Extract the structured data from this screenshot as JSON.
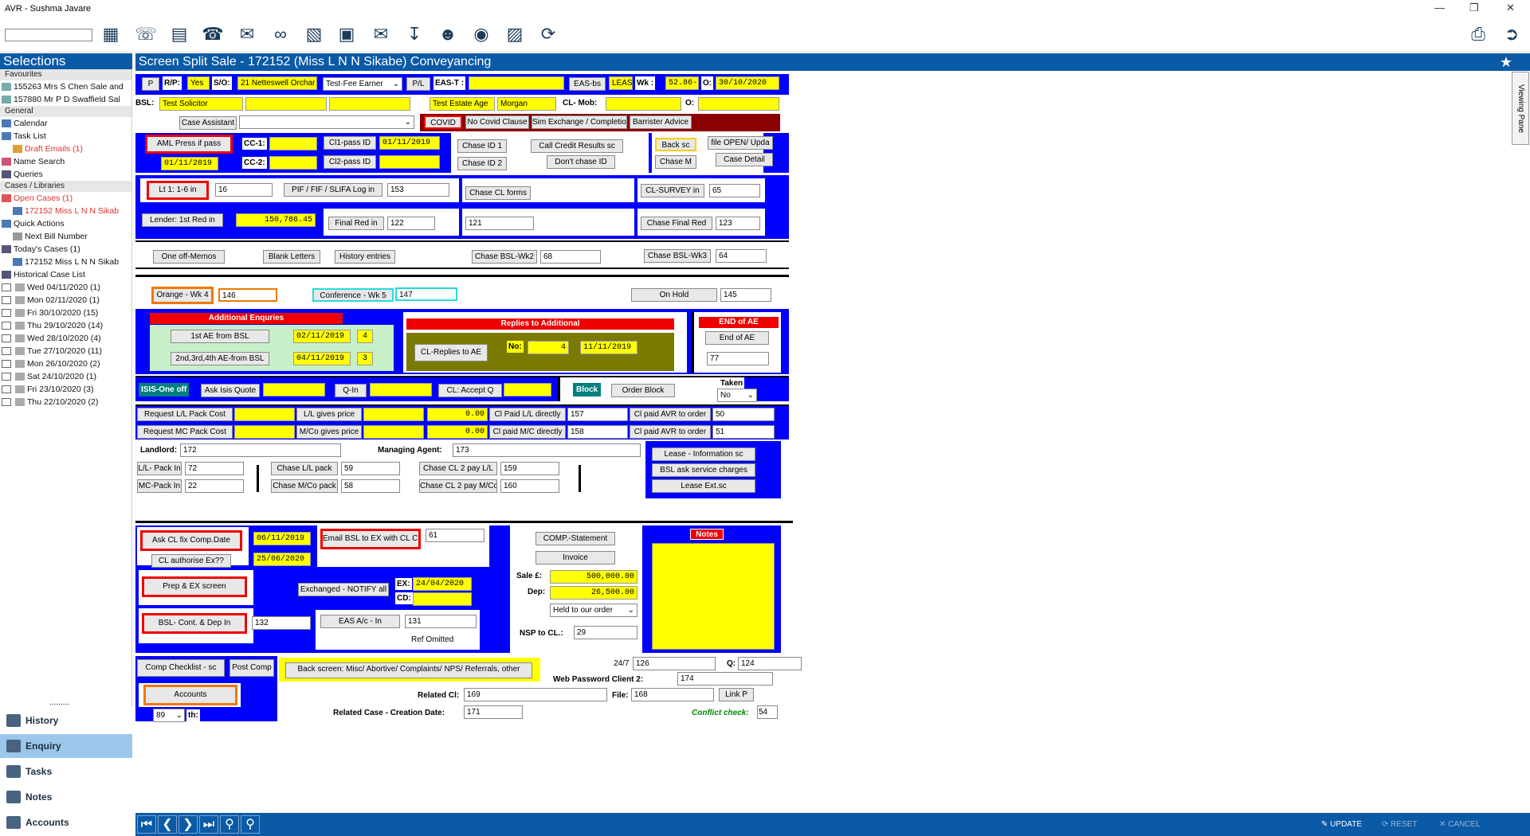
{
  "window": {
    "title": "AVR - Sushma Javare"
  },
  "toolbar": {
    "icons": [
      "add-case-icon",
      "phone-in-icon",
      "notes-icon",
      "phone-out-icon",
      "letter-edit-icon",
      "link-icon",
      "calculator-icon",
      "calendar-icon",
      "mail-icon",
      "download-icon",
      "people-icon",
      "coins-icon",
      "document-export-icon",
      "refresh-icon"
    ],
    "right_icons": [
      "printer-icon",
      "logout-icon"
    ]
  },
  "sidebar": {
    "title": "Selections",
    "favourites_header": "Favourites",
    "favourites": [
      "155263 Mrs S Chen Sale and",
      "157880 Mr P D Swaffield Sal"
    ],
    "general_header": "General",
    "general": [
      "Calendar",
      "Task List",
      "Draft Emails (1)",
      "Name Search",
      "Queries"
    ],
    "cases_header": "Cases / Libraries",
    "cases": [
      "Open Cases  (1)",
      "172152 Miss L N N Sikab",
      "Quick Actions",
      "Next Bill Number",
      "Today's Cases  (1)",
      "172152 Miss L N N Sikab",
      "Historical Case List"
    ],
    "history": [
      "Wed 04/11/2020  (1)",
      "Mon 02/11/2020  (1)",
      "Fri 30/10/2020  (15)",
      "Thu 29/10/2020  (14)",
      "Wed 28/10/2020  (4)",
      "Tue 27/10/2020  (11)",
      "Mon 26/10/2020  (2)",
      "Sat 24/10/2020  (1)",
      "Fri 23/10/2020  (3)",
      "Thu 22/10/2020  (2)"
    ],
    "nav": [
      "History",
      "Enquiry",
      "Tasks",
      "Notes",
      "Accounts"
    ],
    "grip": "........."
  },
  "screen": {
    "title": "Screen Split Sale - 172152 (Miss L N N Sikabe) Conveyancing",
    "viewing_pane": "Viewing Pane"
  },
  "row1": {
    "p": "P",
    "rp_label": "R/P:",
    "rp_value": "Yes",
    "so_label": "S/O:",
    "so_value": "21 Netteswell Orchar",
    "fee_earner": "Test-Fee Earner",
    "pl": "P/L",
    "eas_t": "EAS-T :",
    "eas_bs": "EAS-bs",
    "leas": "LEAS",
    "wk_label": "Wk :",
    "wk_value": "52.86-",
    "o_label": "O:",
    "o_value": "30/10/2020"
  },
  "row2": {
    "bsl_label": "BSL:",
    "bsl_value": "Test Solicitor",
    "estate": "Test Estate Age",
    "estate2": "Morgan",
    "cl_mob": "CL- Mob:",
    "o_label": "O:"
  },
  "row3": {
    "case_assistant": "Case Assistant",
    "covid": "COVID",
    "no_covid": "No Covid Clause",
    "sim_exchange": "Sim Exchange / Completion",
    "barrister": "Barrister Advice"
  },
  "sec1": {
    "aml": "AML Press if pass",
    "aml_date": "01/11/2019",
    "cc1": "CC-1:",
    "cc2": "CC-2:",
    "cl1_pass": "Cl1-pass ID",
    "cl1_date": "01/11/2019",
    "cl2_pass": "Cl2-pass ID",
    "chase_id1": "Chase ID 1",
    "chase_id2": "Chase ID 2",
    "call_credit": "Call Credit Results sc",
    "dont_chase": "Don't chase ID",
    "back_sc": "Back sc",
    "file_open": "file OPEN/ Upda",
    "chase_m": "Chase M",
    "case_detail": "Case Detail"
  },
  "sec2": {
    "lt1": "Lt 1: 1-6 in",
    "lt1_val": "16",
    "pif": "PIF / FIF / SLIFA Log in",
    "pif_val": "153",
    "chase_cl_forms": "Chase CL forms",
    "cl_survey": "CL-SURVEY in",
    "cl_survey_val": "65",
    "lender": "Lender: 1st Red in",
    "lender_val": "150,786.45",
    "final_red": "Final Red in",
    "final_red_val": "122",
    "v121": "121",
    "chase_final_red": "Chase Final Red",
    "chase_final_val": "123"
  },
  "sec3": {
    "one_off": "One off-Memos",
    "blank": "Blank Letters",
    "history_entries": "History entries",
    "chase_bsl2": "Chase BSL-Wk2",
    "bsl2_val": "68",
    "chase_bsl3": "Chase BSL-Wk3",
    "bsl3_val": "64"
  },
  "sec4": {
    "orange": "Orange - Wk 4",
    "orange_val": "146",
    "conf": "Conference - Wk 5",
    "conf_val": "147",
    "on_hold": "On Hold",
    "hold_val": "145"
  },
  "sec5": {
    "add_enq": "Additional Enquries",
    "first_ae": "1st  AE from  BSL",
    "first_ae_date": "02/11/2019",
    "first_ae_n": "4",
    "second_ae": "2nd,3rd,4th AE-from BSL",
    "second_ae_date": "04/11/2019",
    "second_ae_n": "3",
    "replies": "Replies to Additional",
    "cl_replies": "CL-Replies to  AE",
    "no_label": "No:",
    "no_val": "4",
    "replies_date": "11/11/2019",
    "end_ae_hdr": "END of AE",
    "end_ae": "End of AE",
    "end_val": "77"
  },
  "sec6": {
    "isis": "ISIS-One off",
    "ask_isis": "Ask Isis Quote",
    "q_in": "Q-In",
    "cl_accept": "CL: Accept Q",
    "block": "Block",
    "order_block": "Order Block",
    "taken": "Taken",
    "taken_val": "No"
  },
  "sec7": {
    "req_ll": "Request L/L Pack Cost",
    "ll_gives": "L/L gives price",
    "ll_price": "0.00",
    "cl_paid_ll": "Cl Paid L/L directly",
    "cl_paid_ll_val": "157",
    "cl_avr1": "Cl paid AVR to order",
    "cl_avr1_val": "50",
    "req_mc": "Request MC Pack Cost",
    "mc_gives": "M/Co gives price",
    "mc_price": "0.00",
    "cl_paid_mc": "Cl paid M/C directly",
    "cl_paid_mc_val": "158",
    "cl_avr2": "Cl paid AVR to order",
    "cl_avr2_val": "51"
  },
  "sec8": {
    "landlord": "Landlord:",
    "landlord_val": "172",
    "managing": "Managing Agent:",
    "managing_val": "173",
    "ll_pack": "L/L- Pack In",
    "ll_pack_val": "72",
    "mc_pack": "MC-Pack In",
    "mc_pack_val": "22",
    "chase_ll": "Chase L/L pack",
    "chase_ll_val": "59",
    "chase_mc": "Chase M/Co pack",
    "chase_mc_val": "58",
    "cl2pay_ll": "Chase CL 2 pay L/L",
    "cl2pay_ll_val": "159",
    "cl2pay_mc": "Chase CL 2 pay M/Co",
    "cl2pay_mc_val": "160",
    "lease_info": "Lease - Information  sc",
    "bsl_service": "BSL ask service charges",
    "lease_ext": "Lease Ext.sc"
  },
  "sec9": {
    "ask_cl": "Ask CL fix Comp.Date",
    "ask_cl_date": "06/11/2019",
    "cl_auth": "CL authorise Ex??",
    "cl_auth_date": "25/06/2020",
    "email_bsl": "Email BSL to EX with CL CD",
    "email_val": "61",
    "prep": "Prep & EX screen",
    "exchanged": "Exchanged - NOTIFY all",
    "ex_label": "EX:",
    "ex_date": "24/04/2020",
    "cd_label": "CD:",
    "bsl_cont": "BSL- Cont. & Dep In",
    "bsl_cont_val": "132",
    "eas_ac": "EAS A/c - In",
    "eas_ac_val": "131",
    "ref_omitted": "Ref Omitted",
    "comp_statement": "COMP.-Statement",
    "invoice": "Invoice",
    "sale_label": "Sale £:",
    "sale_val": "500,000.00",
    "dep_label": "Dep:",
    "dep_val": "26,500.00",
    "held": "Held to our order",
    "nsp": "NSP to CL.:",
    "nsp_val": "29",
    "notes": "Notes"
  },
  "sec10": {
    "comp_checklist": "Comp Checklist - sc",
    "post_comp": "Post Comp",
    "back_screen": "Back screen: Misc/ Abortive/ Complaints/ NPS/ Referrals, other",
    "h247": "24/7",
    "h247_val": "126",
    "q_label": "Q:",
    "q_val": "124",
    "web_pw": "Web Password Client 2:",
    "web_pw_val": "174",
    "related_cl": "Related Cl:",
    "related_cl_val": "169",
    "file_label": "File:",
    "file_val": "168",
    "link_p": "Link P",
    "related_case": "Related Case - Creation Date:",
    "related_case_val": "171",
    "conflict": "Conflict check:",
    "conflict_val": "54",
    "accounts": "Accounts",
    "acc_val": "89",
    "th": "th:"
  },
  "bottom": {
    "update": "UPDATE",
    "reset": "RESET",
    "cancel": "CANCEL"
  },
  "colors": {
    "accent": "#0b5aa6",
    "form_blue": "#0000ff",
    "field_yellow": "#ffff00",
    "alert_red": "#ee0000"
  }
}
